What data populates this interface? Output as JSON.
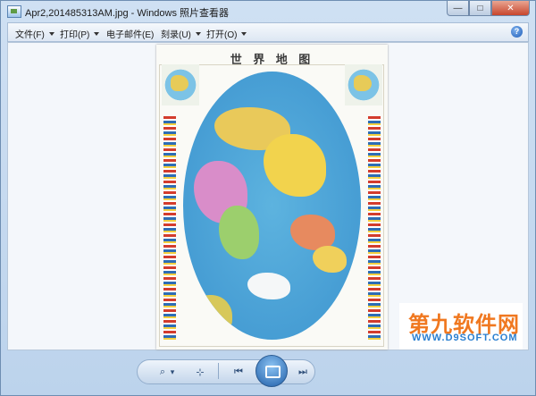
{
  "window": {
    "title": "Apr2,201485313AM.jpg - Windows 照片查看器",
    "buttons": {
      "minimize": "—",
      "maximize": "□",
      "close": "✕"
    }
  },
  "menubar": {
    "items": [
      {
        "label": "文件(F)"
      },
      {
        "label": "打印(P)"
      },
      {
        "label": "电子邮件(E)"
      },
      {
        "label": "刻录(U)"
      },
      {
        "label": "打开(O)"
      }
    ],
    "help": "?"
  },
  "image": {
    "map_title": "世 界 地 图"
  },
  "watermark": {
    "cn": "第九软件网",
    "en": "WWW.D9SOFT.COM"
  },
  "controls": {
    "zoom": "⌕",
    "zoom_caret": "▾",
    "fit": "⊹",
    "prev": "⏮",
    "next": "⏭",
    "rotate_ccw": "⟲",
    "rotate_cw": "⟳",
    "delete": "✕"
  },
  "icons": {
    "app": "photo-viewer-icon",
    "help": "help-icon",
    "zoom": "magnifier-icon",
    "slideshow": "slideshow-icon"
  }
}
